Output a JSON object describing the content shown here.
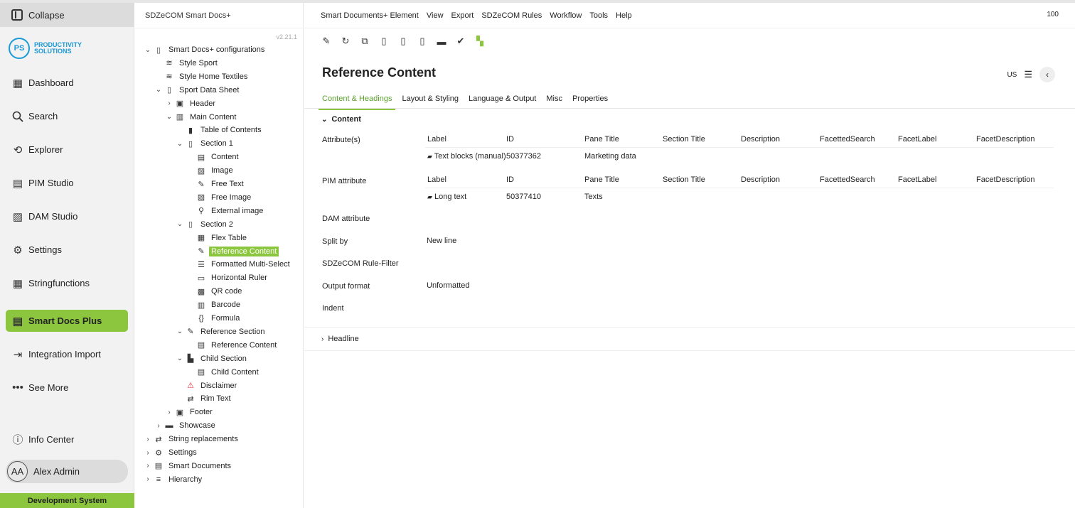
{
  "nav": {
    "collapse": "Collapse",
    "logo": {
      "mark": "PS",
      "line1": "PRODUCTIVITY",
      "line2": "SOLUTIONS"
    },
    "items": [
      {
        "label": "Dashboard",
        "icon": "dashboard-icon"
      },
      {
        "label": "Search",
        "icon": "search-icon"
      },
      {
        "label": "Explorer",
        "icon": "explorer-icon"
      },
      {
        "label": "PIM Studio",
        "icon": "pim-icon"
      },
      {
        "label": "DAM Studio",
        "icon": "image-icon"
      },
      {
        "label": "Settings",
        "icon": "gear-icon"
      },
      {
        "label": "Stringfunctions",
        "icon": "calculator-icon"
      },
      {
        "label": "Smart Docs Plus",
        "icon": "document-icon"
      },
      {
        "label": "Integration Import",
        "icon": "import-icon"
      },
      {
        "label": "See More",
        "icon": "more-icon"
      }
    ],
    "info": "Info Center",
    "user": {
      "initials": "AA",
      "name": "Alex Admin"
    },
    "footer": "Development System"
  },
  "tree": {
    "header": "SDZeCOM Smart Docs+",
    "version": "v2.21.1",
    "nodes": [
      {
        "label": "Smart Docs+ configurations",
        "toggle": "open",
        "icon": "pdf-icon"
      },
      {
        "label": "Style Sport",
        "toggle": "",
        "icon": "style-icon"
      },
      {
        "label": "Style Home Textiles",
        "toggle": "",
        "icon": "style-icon"
      },
      {
        "label": "Sport Data Sheet",
        "toggle": "open",
        "icon": "pdf-icon"
      },
      {
        "label": "Header",
        "toggle": "closed",
        "icon": "header-icon"
      },
      {
        "label": "Main Content",
        "toggle": "open",
        "icon": "columns-icon"
      },
      {
        "label": "Table of Contents",
        "toggle": "",
        "icon": "bookmark-icon"
      },
      {
        "label": "Section 1",
        "toggle": "open",
        "icon": "section-icon"
      },
      {
        "label": "Content",
        "toggle": "",
        "icon": "content-icon"
      },
      {
        "label": "Image",
        "toggle": "",
        "icon": "image-icon"
      },
      {
        "label": "Free Text",
        "toggle": "",
        "icon": "pen-icon"
      },
      {
        "label": "Free Image",
        "toggle": "",
        "icon": "image-icon"
      },
      {
        "label": "External image",
        "toggle": "",
        "icon": "link-icon"
      },
      {
        "label": "Section 2",
        "toggle": "open",
        "icon": "section-icon"
      },
      {
        "label": "Flex Table",
        "toggle": "",
        "icon": "table-icon"
      },
      {
        "label": "Reference Content",
        "toggle": "",
        "icon": "reference-icon",
        "selected": true
      },
      {
        "label": "Formatted Multi-Select",
        "toggle": "",
        "icon": "list-icon"
      },
      {
        "label": "Horizontal Ruler",
        "toggle": "",
        "icon": "ruler-icon"
      },
      {
        "label": "QR code",
        "toggle": "",
        "icon": "qr-icon"
      },
      {
        "label": "Barcode",
        "toggle": "",
        "icon": "barcode-icon"
      },
      {
        "label": "Formula",
        "toggle": "",
        "icon": "formula-icon"
      },
      {
        "label": "Reference Section",
        "toggle": "open",
        "icon": "reference-section-icon"
      },
      {
        "label": "Reference Content",
        "toggle": "",
        "icon": "content-icon"
      },
      {
        "label": "Child Section",
        "toggle": "open",
        "icon": "child-section-icon"
      },
      {
        "label": "Child Content",
        "toggle": "",
        "icon": "content-icon"
      },
      {
        "label": "Disclaimer",
        "toggle": "",
        "icon": "disclaimer-icon"
      },
      {
        "label": "Rim Text",
        "toggle": "",
        "icon": "rim-text-icon"
      },
      {
        "label": "Footer",
        "toggle": "closed",
        "icon": "footer-icon"
      },
      {
        "label": "Showcase",
        "toggle": "closed",
        "icon": "folder-icon"
      },
      {
        "label": "String replacements",
        "toggle": "closed",
        "icon": "swap-icon"
      },
      {
        "label": "Settings",
        "toggle": "closed",
        "icon": "gear-icon"
      },
      {
        "label": "Smart Documents",
        "toggle": "closed",
        "icon": "documents-icon"
      },
      {
        "label": "Hierarchy",
        "toggle": "closed",
        "icon": "hierarchy-icon"
      }
    ]
  },
  "menu": [
    "Smart Documents+ Element",
    "View",
    "Export",
    "SDZeCOM Rules",
    "Workflow",
    "Tools",
    "Help"
  ],
  "zoom": "100",
  "toolbar": [
    "edit-icon",
    "refresh-icon",
    "copy-icon",
    "pdf-icon",
    "preview-icon",
    "export-icon",
    "briefcase-icon",
    "check-icon",
    "workflow-icon"
  ],
  "title": "Reference Content",
  "locale": "US",
  "tabs": [
    "Content & Headings",
    "Layout & Styling",
    "Language & Output",
    "Misc",
    "Properties"
  ],
  "content": {
    "section": "Content",
    "columns": [
      "Label",
      "ID",
      "Pane Title",
      "Section Title",
      "Description",
      "FacettedSearch",
      "FacetLabel",
      "FacetDescription"
    ],
    "rows": {
      "attributes": {
        "label": "Attribute(s)",
        "item_label": "Text blocks (manual)",
        "item_id": "50377362",
        "item_pane": "Marketing data"
      },
      "pim": {
        "label": "PIM attribute",
        "item_label": "Long text",
        "item_id": "50377410",
        "item_pane": "Texts"
      },
      "dam": {
        "label": "DAM attribute"
      },
      "split": {
        "label": "Split by",
        "value": "New line"
      },
      "rule": {
        "label": "SDZeCOM Rule-Filter"
      },
      "output": {
        "label": "Output format",
        "value": "Unformatted"
      },
      "indent": {
        "label": "Indent"
      }
    },
    "headline": "Headline"
  },
  "colors": {
    "accent": "#8cc63f",
    "brand": "#1a9ad6"
  }
}
